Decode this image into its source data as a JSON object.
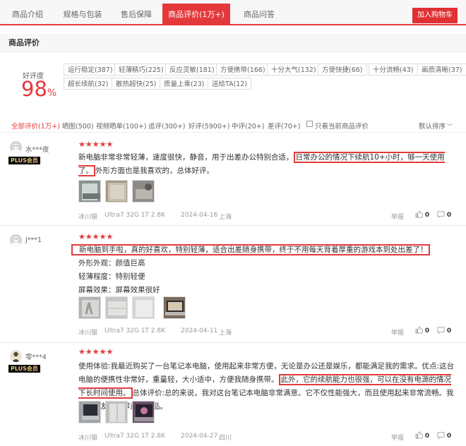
{
  "tabs": [
    "商品介绍",
    "规格与包装",
    "售后保障",
    "商品评价(1万+)",
    "商品问答"
  ],
  "cart_button": "加入购物车",
  "section_title": "商品评价",
  "rating": {
    "label": "好评度",
    "value": "98",
    "unit": "%"
  },
  "tags": [
    "运行稳定(387)",
    "轻薄精巧(225)",
    "反应灵敏(181)",
    "方便携带(166)",
    "十分大气(132)",
    "方便快捷(66)",
    "十分流畅(43)",
    "画质清晰(37)",
    "超长续航(32)",
    "散热超快(25)",
    "质量上乘(23)",
    "送给TA(12)"
  ],
  "filters": [
    "全部评价(1万+)",
    "晒图(500)",
    "视频晒单(100+)",
    "追评(300+)",
    "好评(5900+)",
    "中评(20+)",
    "差评(70+)",
    "只看当前商品评价"
  ],
  "sort": "默认排序",
  "reviews": [
    {
      "user": "水***夜",
      "badge": "PLUS会员",
      "stars": "★★★★★",
      "text_before": "新电脑非常非常轻薄，速度很快，静音，用于出差办公特别合适，",
      "text_highlight": "日常办公的情况下续航10+小时，够一天使用了。",
      "text_after": "外形方面也是我喜欢的，总体好评。",
      "meta": {
        "color": "冰川银",
        "spec": "Ultra7 32G 1T 2.8K",
        "date": "2024-04-16",
        "location": "上海"
      },
      "report": "举报",
      "likes": "0",
      "comments": "0"
    },
    {
      "user": "J***1",
      "stars": "★★★★★",
      "text_highlight": "新电脑到手啦，真的好喜欢，特别轻薄，适合出差随身携带，终于不用每天背着厚重的游戏本到处出差了！",
      "lines": [
        "外形外观：颜值巨高",
        "轻薄程度：特别轻便",
        "屏幕效果：屏幕效果很好"
      ],
      "meta": {
        "color": "冰川银",
        "spec": "Ultra7 32G 1T 2.8K",
        "date": "2024-04-11",
        "location": "上海"
      },
      "report": "举报",
      "likes": "0",
      "comments": "0"
    },
    {
      "user": "零***4",
      "badge": "PLUS会员",
      "stars": "★★★★★",
      "text_before": "使用体验:我最近购买了一台笔记本电脑，使用起来非常方便，无论是办公还是娱乐，都能满足我的需求。优点:这台电脑的便携性非常好，重量轻，大小适中，方便我随身携带。",
      "text_highlight": "此外，它的续航能力也很强，可以在没有电源的情况下长时间使用。",
      "text_after": "总体评价:总的来说，我对这台笔记本电脑非常满意。它不仅性能强大，而且使用起来非常流畅。我会向朋友们推荐这款产品。",
      "meta": {
        "color": "冰川银",
        "spec": "Ultra7 32G 1T 2.8K",
        "date": "2024-04-27",
        "location": "四川"
      },
      "report": "举报",
      "likes": "0",
      "comments": "0"
    }
  ]
}
